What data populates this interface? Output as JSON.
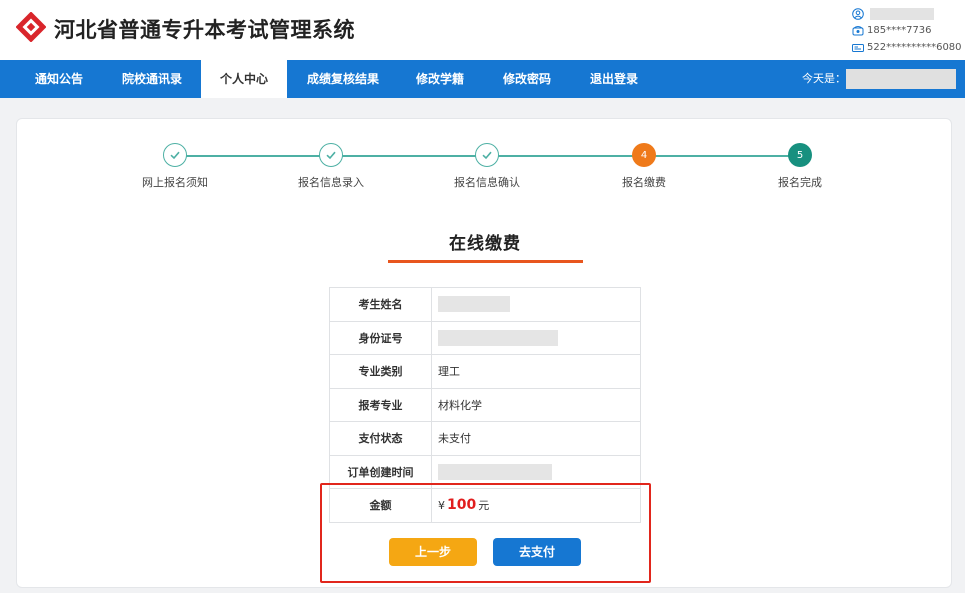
{
  "header": {
    "title": "河北省普通专升本考试管理系统",
    "phone": "185****7736",
    "id_number": "522**********6080"
  },
  "nav": {
    "items": [
      {
        "label": "通知公告"
      },
      {
        "label": "院校通讯录"
      },
      {
        "label": "个人中心",
        "active": true
      },
      {
        "label": "成绩复核结果"
      },
      {
        "label": "修改学籍"
      },
      {
        "label": "修改密码"
      },
      {
        "label": "退出登录"
      }
    ],
    "today_label": "今天是："
  },
  "steps": {
    "items": [
      {
        "label": "网上报名须知",
        "status": "done"
      },
      {
        "label": "报名信息录入",
        "status": "done"
      },
      {
        "label": "报名信息确认",
        "status": "done"
      },
      {
        "label": "报名缴费",
        "status": "current",
        "number": "4"
      },
      {
        "label": "报名完成",
        "status": "todo",
        "number": "5"
      }
    ]
  },
  "payment": {
    "title": "在线缴费",
    "rows": [
      {
        "label": "考生姓名",
        "value": ""
      },
      {
        "label": "身份证号",
        "value": ""
      },
      {
        "label": "专业类别",
        "value": "理工"
      },
      {
        "label": "报考专业",
        "value": "材料化学"
      },
      {
        "label": "支付状态",
        "value": "未支付"
      },
      {
        "label": "订单创建时间",
        "value": ""
      }
    ],
    "amount_label": "金额",
    "currency_symbol": "¥",
    "amount": "100",
    "currency_unit": "元"
  },
  "buttons": {
    "prev": "上一步",
    "pay": "去支付"
  },
  "colors": {
    "nav_blue": "#1677d2",
    "step_done": "#4db0a4",
    "step_current": "#ef7a1a",
    "step_todo": "#17907f",
    "amount_red": "#e11d1d",
    "prev_button": "#f5a713",
    "highlight_border": "#e1261c"
  }
}
